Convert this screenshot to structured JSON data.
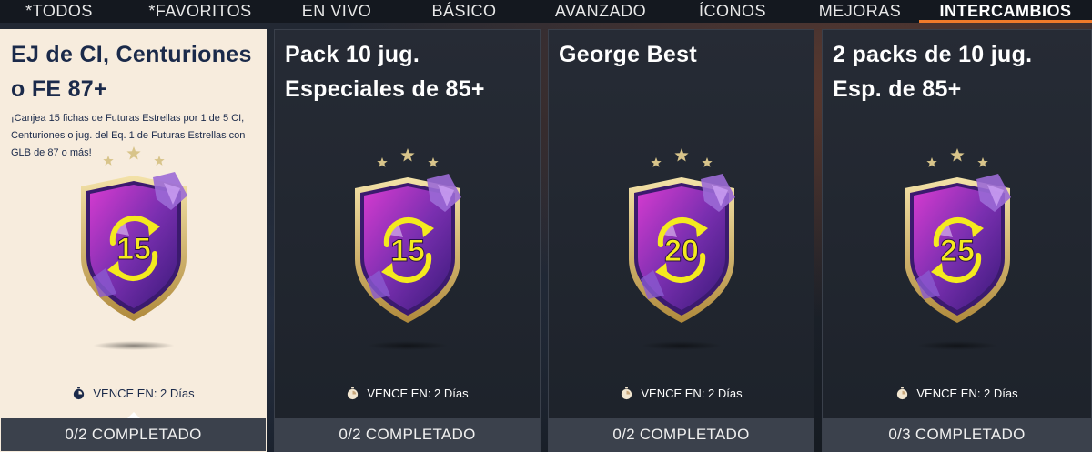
{
  "tabs": [
    {
      "label": "*TODOS"
    },
    {
      "label": "*FAVORITOS"
    },
    {
      "label": "EN VIVO"
    },
    {
      "label": "BÁSICO"
    },
    {
      "label": "AVANZADO"
    },
    {
      "label": "ÍCONOS"
    },
    {
      "label": "MEJORAS"
    },
    {
      "label": "INTERCAMBIOS",
      "active": true
    }
  ],
  "cards": [
    {
      "title": "EJ de CI, Centuriones o FE 87+",
      "description": "¡Canjea 15 fichas de Futuras Estrellas por 1 de 5 CI, Centuriones o jug. del Eq. 1 de Futuras Estrellas con GLB de 87 o más!",
      "badge_number": "15",
      "expiry": "VENCE EN: 2 Días",
      "progress": "0/2 COMPLETADO",
      "selected": true
    },
    {
      "title": "Pack 10 jug. Especiales de 85+",
      "description": "",
      "badge_number": "15",
      "expiry": "VENCE EN: 2 Días",
      "progress": "0/2 COMPLETADO",
      "selected": false
    },
    {
      "title": "George Best",
      "description": "",
      "badge_number": "20",
      "expiry": "VENCE EN: 2 Días",
      "progress": "0/2 COMPLETADO",
      "selected": false
    },
    {
      "title": "2 packs de 10 jug. Esp. de 85+",
      "description": "",
      "badge_number": "25",
      "expiry": "VENCE EN: 2 Días",
      "progress": "0/3 COMPLETADO",
      "selected": false
    }
  ],
  "icons": {
    "timer": "stopwatch-icon",
    "badge": "exchange-badge-icon",
    "stars": "three-stars-icon"
  },
  "colors": {
    "accent": "#f07a2a",
    "selected_card_bg": "#f7ecdd",
    "badge_purple": "#7a2fb0",
    "badge_yellow": "#f4ea1e"
  }
}
